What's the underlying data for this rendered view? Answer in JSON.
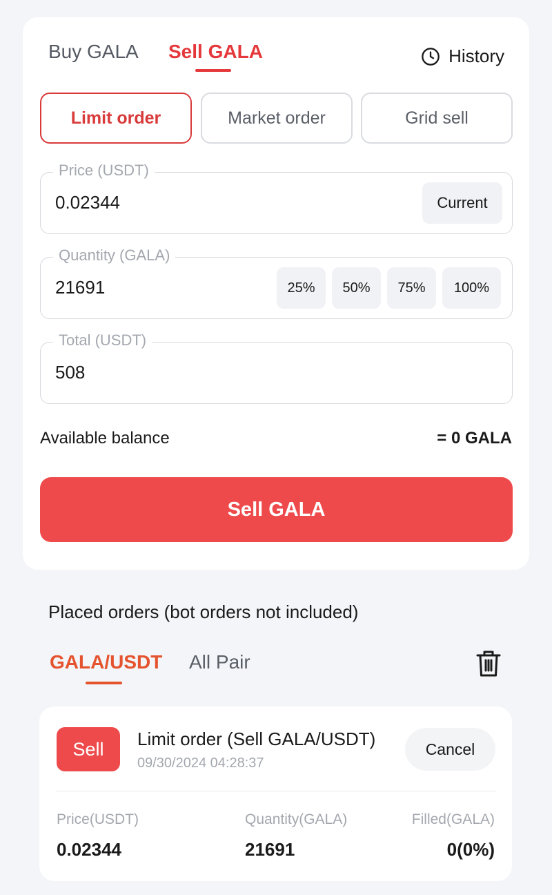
{
  "trade": {
    "tabs": {
      "buy": "Buy GALA",
      "sell": "Sell GALA"
    },
    "history_label": "History",
    "order_types": {
      "limit": "Limit order",
      "market": "Market order",
      "grid": "Grid sell"
    },
    "price": {
      "label": "Price (USDT)",
      "value": "0.02344",
      "current_label": "Current"
    },
    "quantity": {
      "label": "Quantity (GALA)",
      "value": "21691",
      "percents": [
        "25%",
        "50%",
        "75%",
        "100%"
      ]
    },
    "total": {
      "label": "Total (USDT)",
      "value": "508"
    },
    "balance": {
      "label": "Available balance",
      "value": "= 0 GALA"
    },
    "submit_label": "Sell GALA"
  },
  "orders": {
    "title": "Placed orders (bot orders not included)",
    "pair_tabs": {
      "current": "GALA/USDT",
      "all": "All Pair"
    },
    "items": [
      {
        "side": "Sell",
        "title": "Limit order (Sell GALA/USDT)",
        "time": "09/30/2024 04:28:37",
        "cancel_label": "Cancel",
        "columns": {
          "price_label": "Price(USDT)",
          "price_value": "0.02344",
          "qty_label": "Quantity(GALA)",
          "qty_value": "21691",
          "filled_label": "Filled(GALA)",
          "filled_value": "0(0%)"
        }
      }
    ]
  },
  "colors": {
    "accent": "#e5383b",
    "sell_button": "#ee4a4b",
    "pair_accent": "#e4532e"
  },
  "icons": {
    "history": "clock-icon",
    "delete": "trash-icon"
  }
}
